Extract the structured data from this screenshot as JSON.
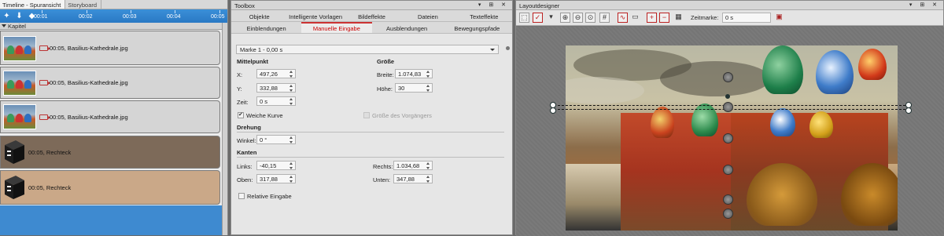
{
  "timeline": {
    "tabs": [
      "Timeline - Spuransicht",
      "Storyboard"
    ],
    "ruler_ticks": [
      "00:01",
      "00:02",
      "00:03",
      "00:04",
      "00:05"
    ],
    "chapter_label": "Kapitel",
    "tracks": [
      {
        "label": "00:05, Basilius-Kathedrale.jpg",
        "kind": "image"
      },
      {
        "label": "00:05, Basilius-Kathedrale.jpg",
        "kind": "image"
      },
      {
        "label": "00:05, Basilius-Kathedrale.jpg",
        "kind": "image"
      },
      {
        "label": "00:05, Rechteck",
        "kind": "rectangle"
      },
      {
        "label": "00:05, Rechteck",
        "kind": "rectangle"
      }
    ]
  },
  "toolbox": {
    "title": "Toolbox",
    "tabs_row1": [
      "Objekte",
      "Intelligente Vorlagen",
      "Bildeffekte",
      "Dateien",
      "Texteffekte"
    ],
    "tabs_row2": [
      "Einblendungen",
      "Manuelle Eingabe",
      "Ausblendungen",
      "Bewegungspfade"
    ],
    "active_tab": "Manuelle Eingabe",
    "marker": "Marke 1 - 0,00 s",
    "mittelpunkt": {
      "title": "Mittelpunkt",
      "x_label": "X:",
      "x": "497,26",
      "y_label": "Y:",
      "y": "332,88",
      "zeit_label": "Zeit:",
      "zeit": "0 s"
    },
    "groesse": {
      "title": "Größe",
      "breite_label": "Breite:",
      "breite": "1.074,83",
      "hoehe_label": "Höhe:",
      "hoehe": "30"
    },
    "weiche_kurve": "Weiche Kurve",
    "groesse_vorgaenger": "Größe des Vorgängers",
    "drehung": {
      "title": "Drehung",
      "winkel_label": "Winkel:",
      "winkel": "0 °"
    },
    "kanten": {
      "title": "Kanten",
      "links_label": "Links:",
      "links": "-40,15",
      "oben_label": "Oben:",
      "oben": "317,88",
      "rechts_label": "Rechts:",
      "rechts": "1.034,68",
      "unten_label": "Unten:",
      "unten": "347,88"
    },
    "relative_eingabe": "Relative Eingabe"
  },
  "designer": {
    "title": "Layoutdesigner",
    "zeitmarke_label": "Zeitmarke:",
    "zeitmarke": "0 s"
  },
  "window_buttons": "▾ ⊞ ✕"
}
